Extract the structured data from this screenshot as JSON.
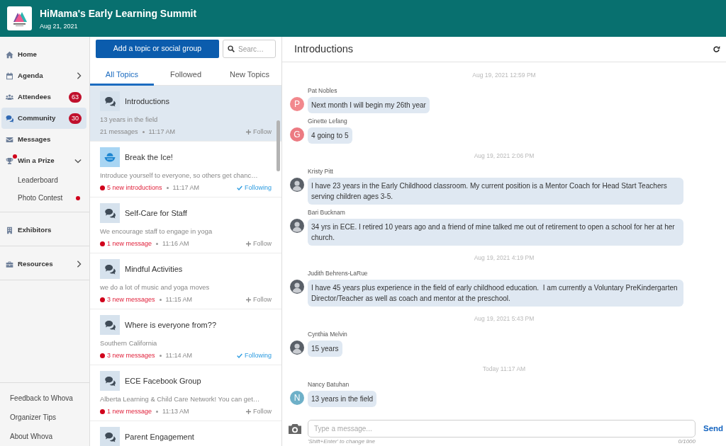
{
  "event": {
    "title": "HiMama's Early Learning Summit",
    "date": "Aug 21, 2021"
  },
  "sidebar": {
    "sections": [
      {
        "items": [
          {
            "label": "Home",
            "selected": false,
            "notification": false
          },
          {
            "label": "Agenda",
            "selected": false,
            "notification": false,
            "expanded": false
          },
          {
            "label": "Attendees",
            "selected": false,
            "notification": false,
            "badge": "63"
          },
          {
            "label": "Community",
            "selected": true,
            "notification": false,
            "badge": "30"
          },
          {
            "label": "Messages",
            "selected": false,
            "notification": false
          },
          {
            "label": "Win a Prize",
            "selected": false,
            "notification": true,
            "expanded": true,
            "children": [
              {
                "label": "Leaderboard",
                "selected": false,
                "notification": false
              },
              {
                "label": "Photo Contest",
                "selected": false,
                "notification": true
              }
            ]
          }
        ]
      },
      {
        "items": [
          {
            "label": "Exhibitors",
            "selected": false,
            "notification": false
          }
        ]
      },
      {
        "items": [
          {
            "label": "Resources",
            "selected": false,
            "notification": false,
            "expanded": false
          }
        ]
      }
    ],
    "footer_links": [
      "Feedback to Whova",
      "Organizer Tips",
      "About Whova"
    ]
  },
  "topics": {
    "add_button": "Add a topic or social group",
    "search": {
      "placeholder": "Searc…"
    },
    "tabs": [
      {
        "label": "All Topics",
        "selected": true
      },
      {
        "label": "Followed",
        "selected": false
      },
      {
        "label": "New Topics",
        "selected": false
      }
    ],
    "items": [
      {
        "kind": "chat",
        "title": "Introductions",
        "preview": "13 years in the field",
        "count": "21 messages",
        "unread": false,
        "time": "11:17 AM",
        "following": false,
        "follow_label": "Follow",
        "selected": true
      },
      {
        "kind": "icebreaker",
        "title": "Break the Ice!",
        "preview": "Introduce yourself to everyone, so others get chanc…",
        "count": "5 new introductions",
        "unread": true,
        "time": "11:17 AM",
        "following": true,
        "follow_label": "Following",
        "selected": false
      },
      {
        "kind": "chat",
        "title": "Self-Care for Staff",
        "preview": "We encourage staff to engage in yoga",
        "count": "1 new message",
        "unread": true,
        "time": "11:16 AM",
        "following": false,
        "follow_label": "Follow",
        "selected": false
      },
      {
        "kind": "chat",
        "title": "Mindful Activities",
        "preview": "we do a lot of music and yoga moves",
        "count": "3 new messages",
        "unread": true,
        "time": "11:15 AM",
        "following": false,
        "follow_label": "Follow",
        "selected": false
      },
      {
        "kind": "chat",
        "title": "Where is everyone from??",
        "preview": "Southern California",
        "count": "3 new messages",
        "unread": true,
        "time": "11:14 AM",
        "following": true,
        "follow_label": "Following",
        "selected": false
      },
      {
        "kind": "chat",
        "title": "ECE Facebook Group",
        "preview": "Alberta Learning & Child Care Network! You can get…",
        "count": "1 new message",
        "unread": true,
        "time": "11:13 AM",
        "following": false,
        "follow_label": "Follow",
        "selected": false
      },
      {
        "kind": "chat",
        "title": "Parent Engagement",
        "selected": false
      }
    ]
  },
  "chat": {
    "title": "Introductions",
    "messages": [
      {
        "kind": "timestamp",
        "text": "Aug 19, 2021 12:59 PM"
      },
      {
        "kind": "message",
        "author": "Pat Nobles",
        "text": "Next month I will begin my 26th year",
        "avatar": {
          "kind": "initial",
          "letter": "P",
          "color": "#f2888d"
        }
      },
      {
        "kind": "message",
        "author": "Ginette Lefang",
        "text": "4 going to 5",
        "avatar": {
          "kind": "initial",
          "letter": "G",
          "color": "#ec7a82"
        }
      },
      {
        "kind": "timestamp",
        "text": "Aug 19, 2021 2:06 PM"
      },
      {
        "kind": "message",
        "author": "Kristy Pitt",
        "text": "I have 23 years in the Early Childhood classroom. My current position is a Mentor Coach for Head Start Teachers serving children ages 3-5.",
        "avatar": {
          "kind": "photo"
        }
      },
      {
        "kind": "message",
        "author": "Bari Bucknam",
        "text": "34 yrs in ECE. I retired 10 years ago and a friend of mine talked me out of retirement to open a school for her at her church.",
        "avatar": {
          "kind": "photo"
        }
      },
      {
        "kind": "timestamp",
        "text": "Aug 19, 2021 4:19 PM"
      },
      {
        "kind": "message",
        "author": "Judith Behrens-LaRue",
        "text": "I have 45 years plus experience in the field of early childhood education.  I am currently a Voluntary PreKindergarten Director/Teacher as well as coach and mentor at the preschool.",
        "avatar": {
          "kind": "photo"
        }
      },
      {
        "kind": "timestamp",
        "text": "Aug 19, 2021 5:43 PM"
      },
      {
        "kind": "message",
        "author": "Cynthia Melvin",
        "text": "15 years",
        "avatar": {
          "kind": "photo"
        }
      },
      {
        "kind": "timestamp",
        "text": "Today 11:17 AM"
      },
      {
        "kind": "message",
        "author": "Nancy Batuhan",
        "text": "13 years in the field",
        "avatar": {
          "kind": "initial",
          "letter": "N",
          "color": "#6eb0c8"
        }
      }
    ],
    "composer": {
      "placeholder": "Type a message...",
      "hint": "'Shift+Enter' to change line",
      "counter": "0/1000",
      "send": "Send"
    }
  }
}
